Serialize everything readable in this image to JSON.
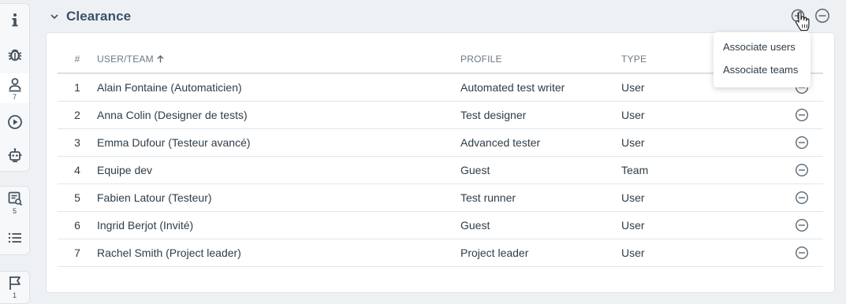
{
  "rail": {
    "groups": [
      {
        "items": [
          {
            "icon": "info-icon"
          },
          {
            "icon": "bug-icon"
          },
          {
            "icon": "user-clearance-icon",
            "count": "7",
            "active": true
          },
          {
            "icon": "play-circle-icon"
          },
          {
            "icon": "robot-icon"
          }
        ]
      },
      {
        "items": [
          {
            "icon": "test-plan-icon",
            "count": "5"
          },
          {
            "icon": "list-icon"
          }
        ]
      },
      {
        "items": [
          {
            "icon": "flag-icon",
            "count": "1"
          }
        ]
      }
    ]
  },
  "section": {
    "title": "Clearance"
  },
  "table": {
    "headers": {
      "num": "#",
      "user": "USER/TEAM",
      "profile": "PROFILE",
      "type": "TYPE"
    },
    "sort": {
      "column": "user",
      "direction": "asc"
    },
    "rows": [
      {
        "num": "1",
        "user": "Alain Fontaine (Automaticien)",
        "profile": "Automated test writer",
        "type": "User"
      },
      {
        "num": "2",
        "user": "Anna Colin (Designer de tests)",
        "profile": "Test designer",
        "type": "User"
      },
      {
        "num": "3",
        "user": "Emma Dufour (Testeur avancé)",
        "profile": "Advanced tester",
        "type": "User"
      },
      {
        "num": "4",
        "user": "Equipe dev",
        "profile": "Guest",
        "type": "Team"
      },
      {
        "num": "5",
        "user": "Fabien Latour (Testeur)",
        "profile": "Test runner",
        "type": "User"
      },
      {
        "num": "6",
        "user": "Ingrid Berjot (Invité)",
        "profile": "Guest",
        "type": "User"
      },
      {
        "num": "7",
        "user": "Rachel Smith (Project leader)",
        "profile": "Project leader",
        "type": "User"
      }
    ]
  },
  "menu": {
    "items": [
      "Associate users",
      "Associate teams"
    ]
  },
  "colors": {
    "title": "#3a5068",
    "icon": "#5b6873",
    "panel_bg": "#ffffff",
    "page_bg": "#eef1f4"
  }
}
